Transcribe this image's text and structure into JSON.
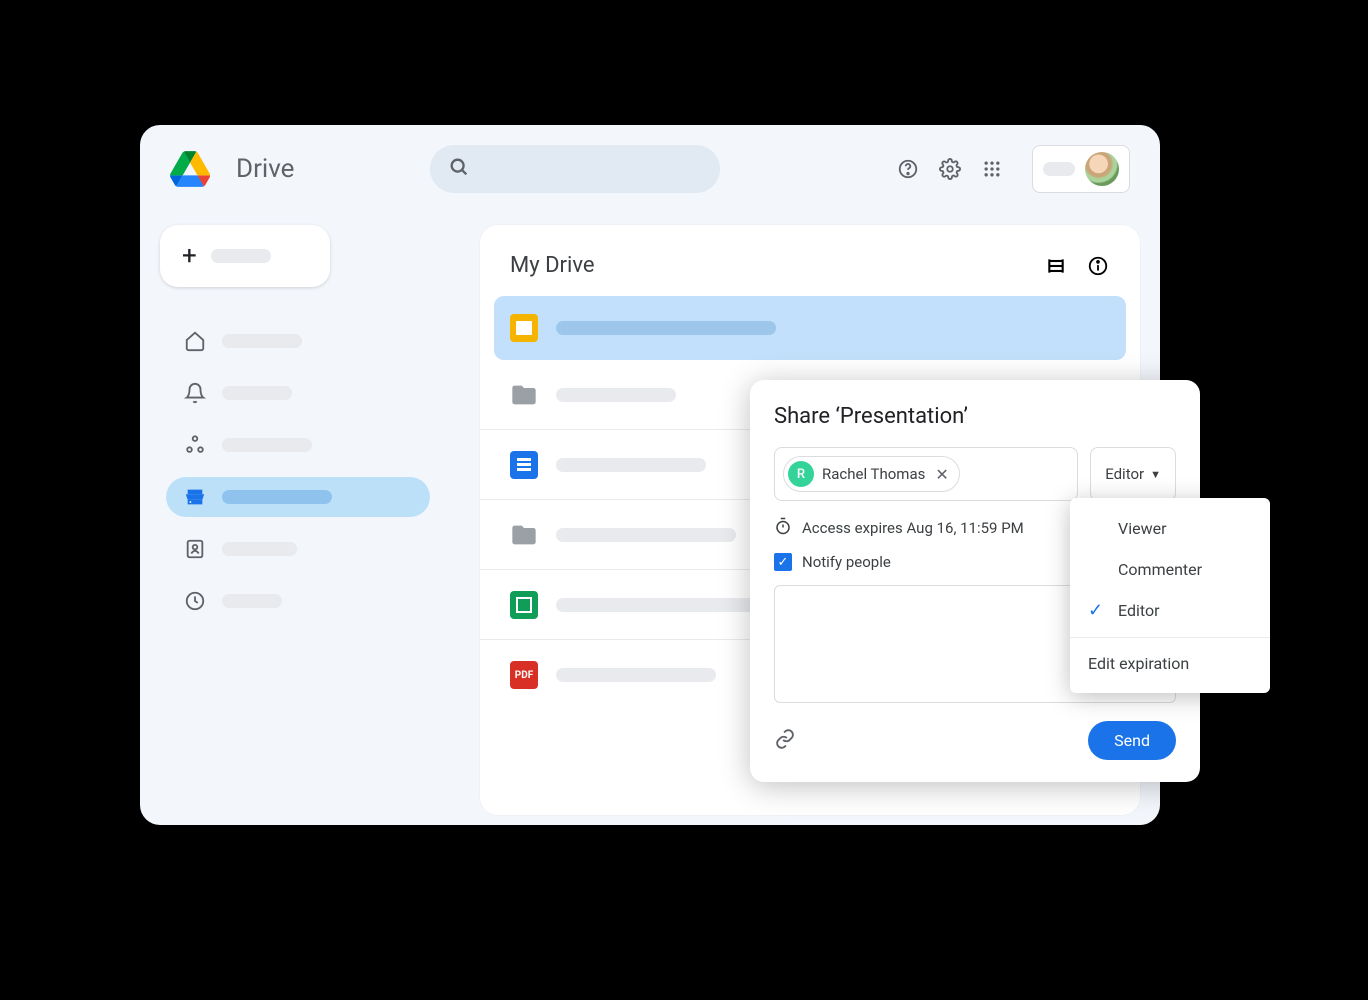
{
  "app": {
    "title": "Drive"
  },
  "main": {
    "title": "My Drive"
  },
  "sidebar": {
    "nav_icons": [
      "home",
      "bell",
      "share",
      "storage",
      "contacts",
      "clock"
    ]
  },
  "files": {
    "row1_icon": "slides",
    "row2_icon": "folder",
    "row3_icon": "doc",
    "row4_icon": "folder",
    "row5_icon": "sheet",
    "row6_icon": "pdf",
    "pdf_label": "PDF"
  },
  "share": {
    "title": "Share ‘Presentation’",
    "person_initial": "R",
    "person_name": "Rachel Thomas",
    "role_selected": "Editor",
    "expiry_text": "Access expires Aug 16, 11:59 PM",
    "notify_label": "Notify people",
    "send_label": "Send"
  },
  "role_menu": {
    "viewer": "Viewer",
    "commenter": "Commenter",
    "editor": "Editor",
    "edit_expiration": "Edit expiration"
  }
}
